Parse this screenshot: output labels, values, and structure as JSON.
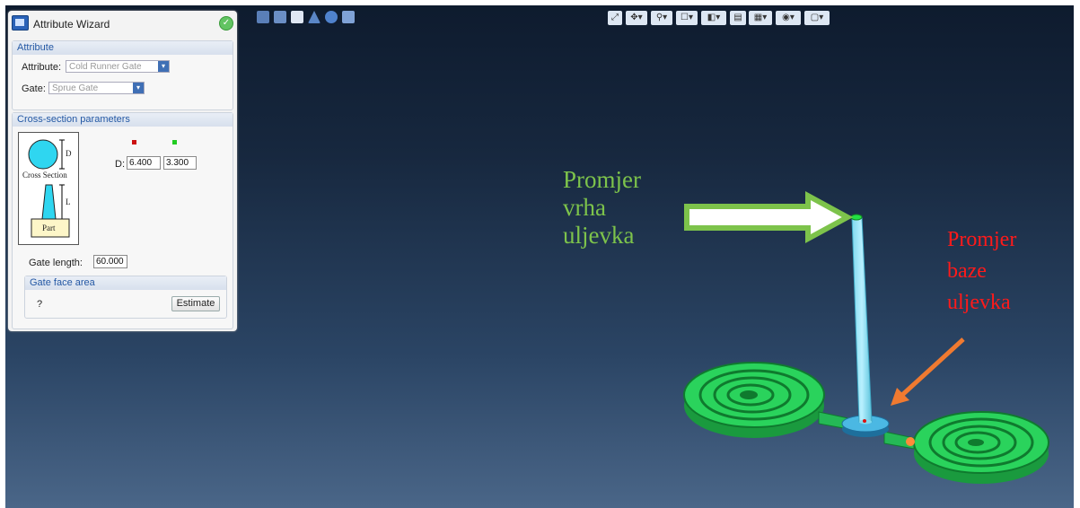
{
  "wizard": {
    "title": "Attribute Wizard",
    "attribute_group": {
      "header": "Attribute",
      "attribute_label": "Attribute:",
      "attribute_value": "Cold Runner Gate",
      "gate_label": "Gate:",
      "gate_value": "Sprue Gate"
    },
    "cross_section": {
      "header": "Cross-section parameters",
      "diagram_labels": {
        "d": "D",
        "cross_section": "Cross Section",
        "l": "L",
        "part": "Part"
      },
      "d_label": "D:",
      "d_start": "6.400",
      "d_end": "3.300",
      "marker_colors": {
        "start": "#cc1111",
        "end": "#22cc22"
      },
      "gate_length_label": "Gate length:",
      "gate_length_value": "60.000",
      "face_area": {
        "header": "Gate face area",
        "value": "?",
        "estimate_label": "Estimate"
      }
    }
  },
  "left_toolbar": [
    "list-icon",
    "tree-icon",
    "person-icon",
    "cone-icon",
    "info-icon",
    "collapse-icon"
  ],
  "right_toolbar": [
    "fit-icon",
    "rotate-icon",
    "zoom-icon",
    "window-icon",
    "cube-icon",
    "page-icon",
    "all-icon",
    "eye-icon",
    "frame-icon"
  ],
  "annotations": {
    "green": [
      "Promjer",
      "vrha",
      "uljevka"
    ],
    "red": [
      "Promjer",
      "baze",
      "uljevka"
    ],
    "green_color": "#7dc34b",
    "red_color": "#ff1a1a",
    "arrow_color": "#f07a30"
  }
}
